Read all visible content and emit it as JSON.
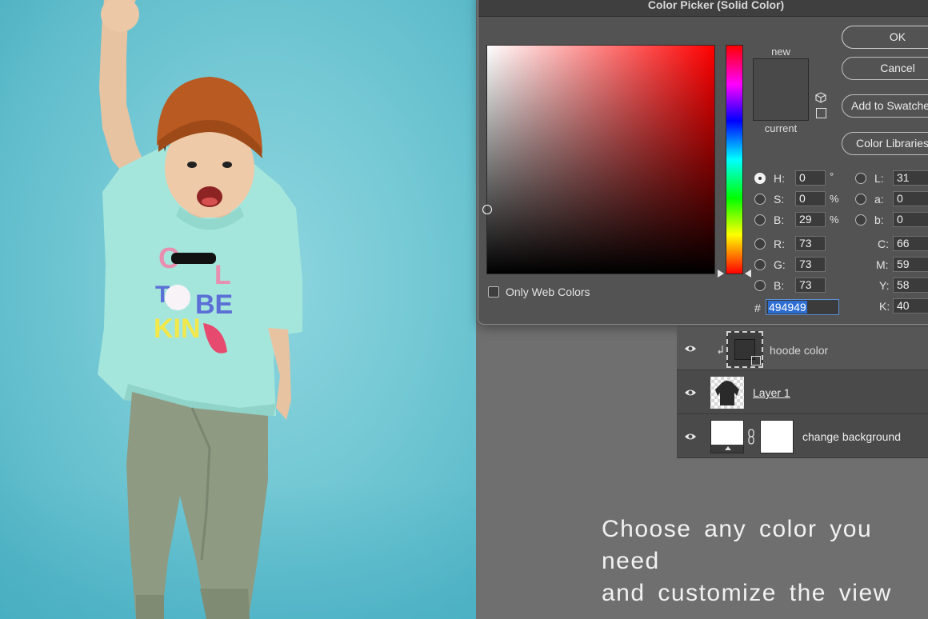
{
  "dialog": {
    "title": "Color Picker (Solid Color)",
    "new_label": "new",
    "current_label": "current",
    "new_color": "#494949",
    "current_color": "#494949",
    "hue_base_color": "#ff0000",
    "buttons": {
      "ok": "OK",
      "cancel": "Cancel",
      "add_to_swatches": "Add to Swatches",
      "color_libraries": "Color Libraries"
    },
    "fields": {
      "h": {
        "label": "H:",
        "value": "0",
        "unit": "°"
      },
      "s": {
        "label": "S:",
        "value": "0",
        "unit": "%"
      },
      "b": {
        "label": "B:",
        "value": "29",
        "unit": "%"
      },
      "r": {
        "label": "R:",
        "value": "73"
      },
      "g": {
        "label": "G:",
        "value": "73"
      },
      "b2": {
        "label": "B:",
        "value": "73"
      },
      "l": {
        "label": "L:",
        "value": "31"
      },
      "a": {
        "label": "a:",
        "value": "0"
      },
      "lab_b": {
        "label": "b:",
        "value": "0"
      },
      "c": {
        "label": "C:",
        "value": "66"
      },
      "m": {
        "label": "M:",
        "value": "59"
      },
      "y": {
        "label": "Y:",
        "value": "58"
      },
      "k": {
        "label": "K:",
        "value": "40"
      }
    },
    "hex_label": "#",
    "hex_value": "494949",
    "only_web_colors_label": "Only Web Colors"
  },
  "layers": [
    {
      "name": "hoode color",
      "visible": true,
      "icon": "color-fill-layer-thumbnail"
    },
    {
      "name": "Layer 1",
      "visible": true,
      "icon": "hoodie-thumbnail"
    },
    {
      "name": "change background",
      "visible": true,
      "icon": "white-layer-thumbnail"
    }
  ],
  "caption": {
    "line1": "Choose any color you need",
    "line2": "and customize the view"
  },
  "photo": {
    "shirt_lettering": [
      "Cool",
      "To",
      "BE",
      "KIND"
    ],
    "background_color": "#73c8d4",
    "shirt_color": "#a5e6dc",
    "hat_color": "#b85a22",
    "pants_color": "#8e9a82"
  }
}
